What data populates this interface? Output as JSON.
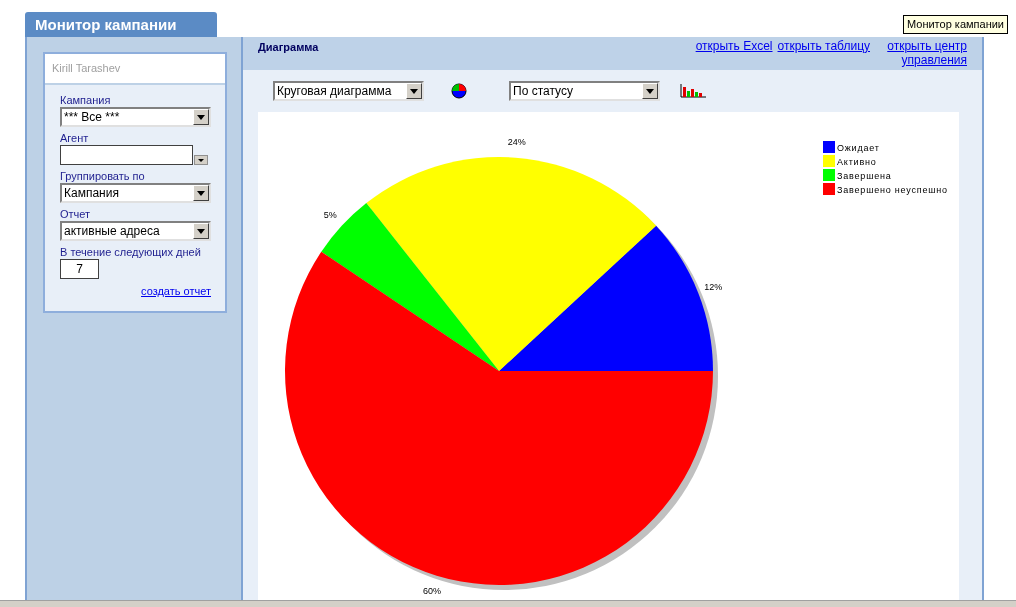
{
  "tooltip": "Монитор кампании",
  "tab": {
    "label": "Монитор кампании",
    "selected": true
  },
  "sidebar": {
    "user": "Kirill Tarashev",
    "fields": [
      {
        "label": "Кампания",
        "kind": "select",
        "value": "*** Все ***"
      },
      {
        "label": "Агент",
        "kind": "combo"
      },
      {
        "label": "Группировать по",
        "kind": "select",
        "value": "Кампания"
      },
      {
        "label": "Отчет",
        "kind": "select",
        "value": "активные адреса"
      },
      {
        "label": "В течение следующих дней",
        "kind": "number",
        "value": "7"
      }
    ],
    "link": "создать отчет"
  },
  "panel": {
    "title": "Диаграмма",
    "links": [
      "открыть Excel",
      "открыть таблицу",
      "открыть центр управления"
    ],
    "chart_type": "Круговая диаграмма",
    "group_by": "По статусу",
    "chart_data": {
      "type": "pie",
      "categories": [
        "Ожидает",
        "Активно",
        "Завершена",
        "Завершено неуспешно"
      ],
      "values": [
        12,
        24,
        5,
        60
      ],
      "legend": "right",
      "colors": [
        "#0000ff",
        "#ffff00",
        "#00ff00",
        "#ff0000"
      ],
      "value_labels": [
        "12%",
        "24%",
        "5%",
        "60%"
      ]
    }
  }
}
